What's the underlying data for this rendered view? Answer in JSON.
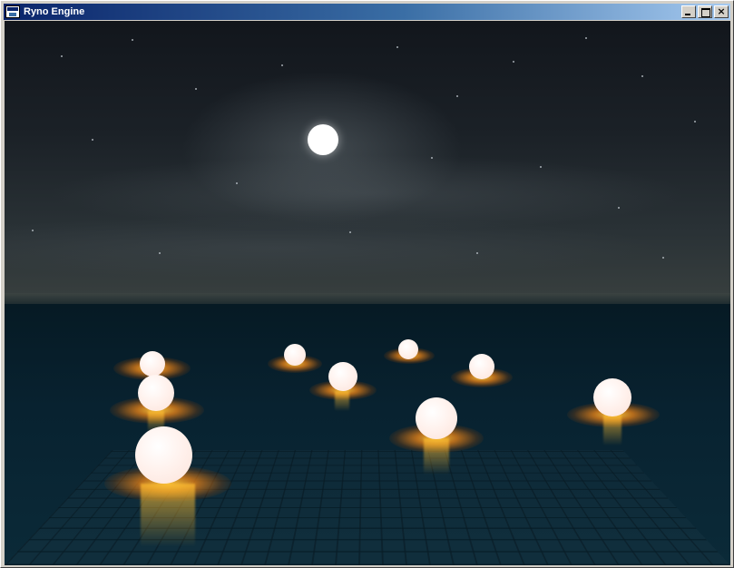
{
  "window": {
    "title": "Ryno Engine",
    "controls": {
      "minimize": "",
      "maximize": "",
      "close": "×"
    }
  },
  "scene": {
    "sky_color": "#12161c",
    "ground_color": "#082230",
    "moon_color": "#ffffff",
    "light_color": "#ffb43c",
    "sphere_color": "#fdeee9",
    "light_orb_count": 9
  }
}
